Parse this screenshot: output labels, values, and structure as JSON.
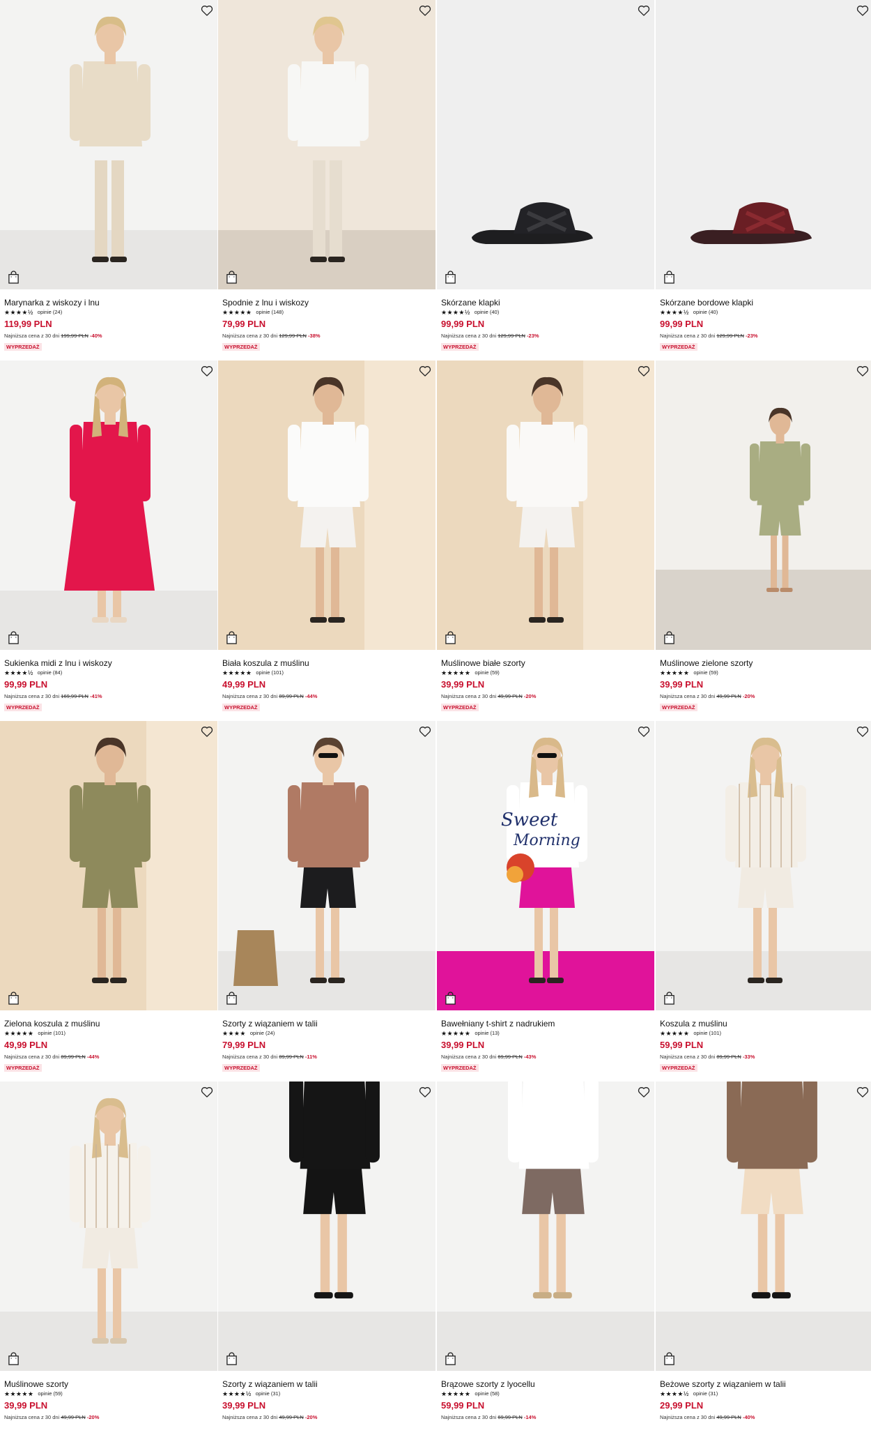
{
  "icons": {
    "wishlist": "heart-outline-icon",
    "cart": "shopping-bag-icon"
  },
  "colors": {
    "price": "#c8102e",
    "badge_bg": "#fbe3e6",
    "badge_text": "#c8102e"
  },
  "products": [
    {
      "name": "Marynarka z wiskozy i lnu",
      "stars": "★★★★½",
      "reviews": "opinie (24)",
      "price": "119,99 PLN",
      "lowest_label": "Najniższa cena z 30 dni",
      "old_price": "199,99 PLN",
      "discount": "-40%",
      "badge": "WYPRZEDAŻ"
    },
    {
      "name": "Spodnie z lnu i wiskozy",
      "stars": "★★★★★",
      "reviews": "opinie (148)",
      "price": "79,99 PLN",
      "lowest_label": "Najniższa cena z 30 dni",
      "old_price": "129,99 PLN",
      "discount": "-38%",
      "badge": "WYPRZEDAŻ"
    },
    {
      "name": "Skórzane klapki",
      "stars": "★★★★½",
      "reviews": "opinie (40)",
      "price": "99,99 PLN",
      "lowest_label": "Najniższa cena z 30 dni",
      "old_price": "129,99 PLN",
      "discount": "-23%",
      "badge": "WYPRZEDAŻ"
    },
    {
      "name": "Skórzane bordowe klapki",
      "stars": "★★★★½",
      "reviews": "opinie (40)",
      "price": "99,99 PLN",
      "lowest_label": "Najniższa cena z 30 dni",
      "old_price": "129,99 PLN",
      "discount": "-23%",
      "badge": "WYPRZEDAŻ"
    },
    {
      "name": "Sukienka midi z lnu i wiskozy",
      "stars": "★★★★½",
      "reviews": "opinie (84)",
      "price": "99,99 PLN",
      "lowest_label": "Najniższa cena z 30 dni",
      "old_price": "169,99 PLN",
      "discount": "-41%",
      "badge": "WYPRZEDAŻ"
    },
    {
      "name": "Biała koszula z muślinu",
      "stars": "★★★★★",
      "reviews": "opinie (101)",
      "price": "49,99 PLN",
      "lowest_label": "Najniższa cena z 30 dni",
      "old_price": "89,99 PLN",
      "discount": "-44%",
      "badge": "WYPRZEDAŻ"
    },
    {
      "name": "Muślinowe białe szorty",
      "stars": "★★★★★",
      "reviews": "opinie (59)",
      "price": "39,99 PLN",
      "lowest_label": "Najniższa cena z 30 dni",
      "old_price": "49,99 PLN",
      "discount": "-20%",
      "badge": "WYPRZEDAŻ"
    },
    {
      "name": "Muślinowe zielone szorty",
      "stars": "★★★★★",
      "reviews": "opinie (59)",
      "price": "39,99 PLN",
      "lowest_label": "Najniższa cena z 30 dni",
      "old_price": "49,99 PLN",
      "discount": "-20%",
      "badge": "WYPRZEDAŻ"
    },
    {
      "name": "Zielona koszula z muślinu",
      "stars": "★★★★★",
      "reviews": "opinie (101)",
      "price": "49,99 PLN",
      "lowest_label": "Najniższa cena z 30 dni",
      "old_price": "89,99 PLN",
      "discount": "-44%",
      "badge": "WYPRZEDAŻ"
    },
    {
      "name": "Szorty z wiązaniem w talii",
      "stars": "★★★★",
      "reviews": "opinie (24)",
      "price": "79,99 PLN",
      "lowest_label": "Najniższa cena z 30 dni",
      "old_price": "89,99 PLN",
      "discount": "-11%",
      "badge": "WYPRZEDAŻ"
    },
    {
      "name": "Bawełniany t-shirt z nadrukiem",
      "stars": "★★★★★",
      "reviews": "opinie (13)",
      "price": "39,99 PLN",
      "lowest_label": "Najniższa cena z 30 dni",
      "old_price": "69,99 PLN",
      "discount": "-43%",
      "badge": "WYPRZEDAŻ"
    },
    {
      "name": "Koszula z muślinu",
      "stars": "★★★★★",
      "reviews": "opinie (101)",
      "price": "59,99 PLN",
      "lowest_label": "Najniższa cena z 30 dni",
      "old_price": "89,99 PLN",
      "discount": "-33%",
      "badge": "WYPRZEDAŻ"
    },
    {
      "name": "Muślinowe szorty",
      "stars": "★★★★★",
      "reviews": "opinie (59)",
      "price": "39,99 PLN",
      "lowest_label": "Najniższa cena z 30 dni",
      "old_price": "49,99 PLN",
      "discount": "-20%",
      "badge": ""
    },
    {
      "name": "Szorty z wiązaniem w talii",
      "stars": "★★★★½",
      "reviews": "opinie (31)",
      "price": "39,99 PLN",
      "lowest_label": "Najniższa cena z 30 dni",
      "old_price": "49,99 PLN",
      "discount": "-20%",
      "badge": ""
    },
    {
      "name": "Brązowe szorty z lyocellu",
      "stars": "★★★★★",
      "reviews": "opinie (58)",
      "price": "59,99 PLN",
      "lowest_label": "Najniższa cena z 30 dni",
      "old_price": "69,99 PLN",
      "discount": "-14%",
      "badge": ""
    },
    {
      "name": "Beżowe szorty z wiązaniem w talii",
      "stars": "★★★★½",
      "reviews": "opinie (31)",
      "price": "29,99 PLN",
      "lowest_label": "Najniższa cena z 30 dni",
      "old_price": "49,99 PLN",
      "discount": "-40%",
      "badge": ""
    }
  ]
}
